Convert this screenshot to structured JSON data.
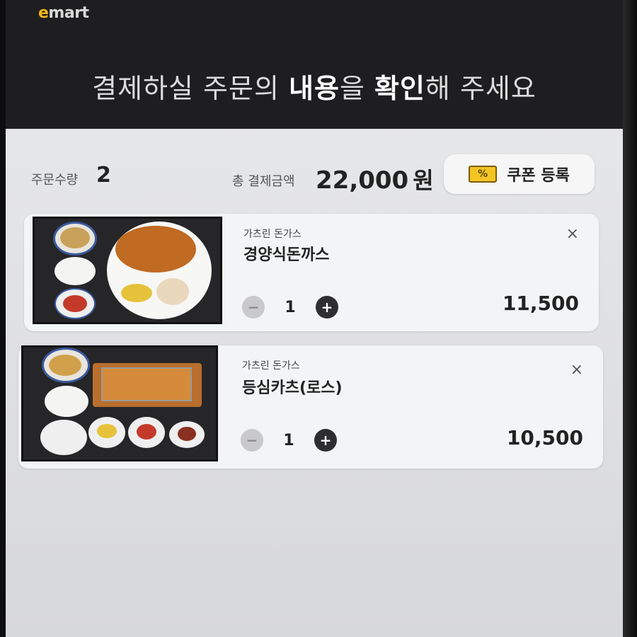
{
  "brand": {
    "logo_e": "e",
    "logo_rest": "mart"
  },
  "header": {
    "title_part1": "결제하실 주문의 ",
    "title_bold1": "내용",
    "title_part2": "을 ",
    "title_bold2": "확인",
    "title_part3": "해 주세요"
  },
  "summary": {
    "qty_label": "주문수량",
    "qty_value": "2",
    "total_label": "총 결제금액",
    "total_value": "22,000",
    "total_unit": "원",
    "coupon_label": "쿠폰 등록",
    "coupon_icon": "%"
  },
  "items": [
    {
      "brand": "가츠린 돈가스",
      "name": "경양식돈까스",
      "qty": "1",
      "price": "11,500",
      "close": "×",
      "minus": "−",
      "plus": "+",
      "image": "cutlet-set-image"
    },
    {
      "brand": "가츠린 돈가스",
      "name": "등심카츠(로스)",
      "qty": "1",
      "price": "10,500",
      "close": "×",
      "minus": "−",
      "plus": "+",
      "image": "loin-katsu-set-image"
    }
  ],
  "colors": {
    "header_bg": "#1e1e20",
    "logo_accent": "#f2b51c",
    "coupon_icon": "#f3c423",
    "plus_button": "#2e2e30"
  }
}
